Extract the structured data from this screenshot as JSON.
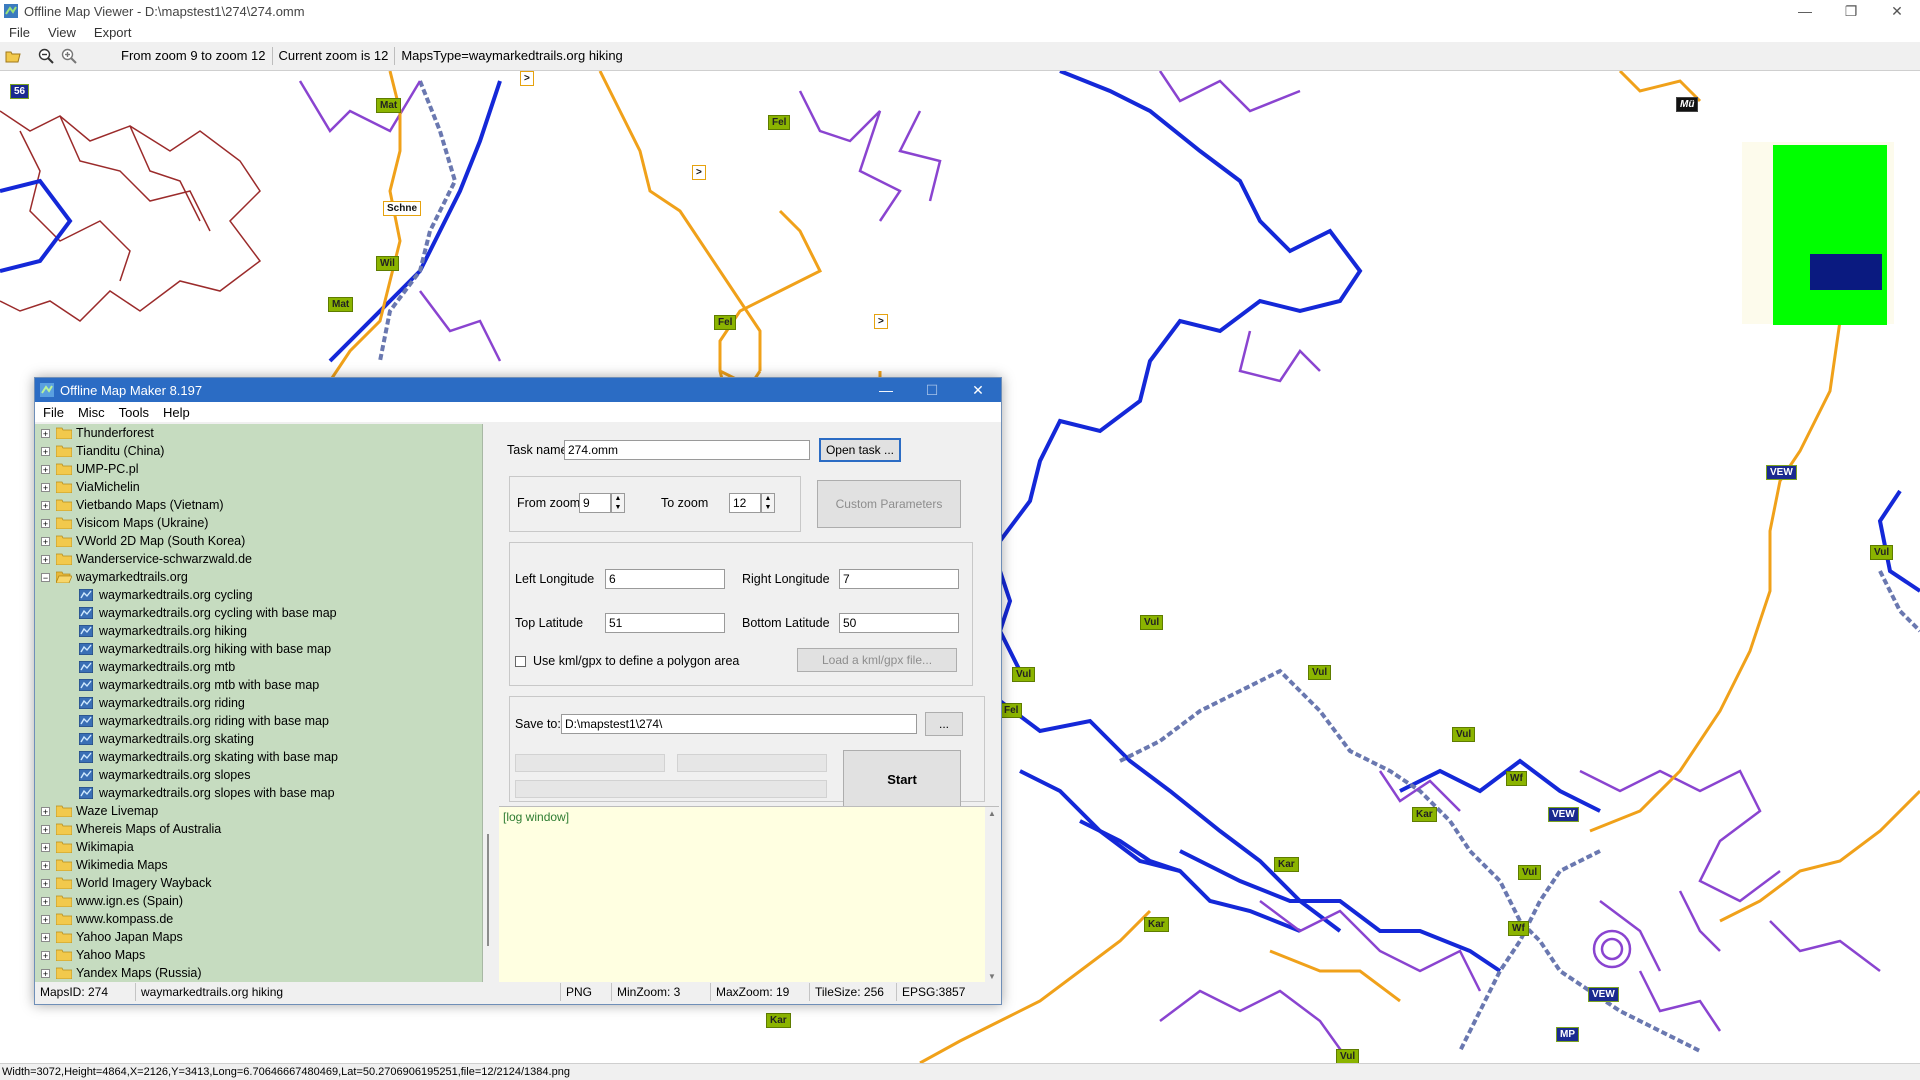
{
  "window": {
    "title": "Offline Map Viewer - D:\\mapstest1\\274\\274.omm"
  },
  "menu": [
    "File",
    "View",
    "Export"
  ],
  "toolbar": {
    "zoom_range": "From zoom 9 to zoom 12",
    "current_zoom": "Current zoom is 12",
    "maps_type": "MapsType=waymarkedtrails.org hiking"
  },
  "map_labels": [
    {
      "text": "56",
      "style": "navy"
    },
    {
      "text": "Mat",
      "style": "green"
    },
    {
      "text": "Fel",
      "style": "green"
    },
    {
      "text": ">",
      "style": "white"
    },
    {
      "text": "Schne",
      "style": "white"
    },
    {
      "text": "Wil",
      "style": "green"
    },
    {
      "text": "Mat",
      "style": "green"
    },
    {
      "text": "Fel",
      "style": "green"
    },
    {
      "text": ">",
      "style": "white"
    },
    {
      "text": ">",
      "style": "white"
    },
    {
      "text": "Mü",
      "style": "black"
    },
    {
      "text": "VEW",
      "style": "navy"
    },
    {
      "text": "Vul",
      "style": "green"
    },
    {
      "text": "Vul",
      "style": "green"
    },
    {
      "text": "Vul",
      "style": "green"
    },
    {
      "text": "Vul",
      "style": "green"
    },
    {
      "text": "Fel",
      "style": "green"
    },
    {
      "text": "Vul",
      "style": "green"
    },
    {
      "text": "Wf",
      "style": "green"
    },
    {
      "text": "Kar",
      "style": "green"
    },
    {
      "text": "VEW",
      "style": "navy"
    },
    {
      "text": "Kar",
      "style": "green"
    },
    {
      "text": "Vul",
      "style": "green"
    },
    {
      "text": "Kar",
      "style": "green"
    },
    {
      "text": "Wf",
      "style": "green"
    },
    {
      "text": "VEW",
      "style": "navy"
    },
    {
      "text": "MP",
      "style": "navy"
    },
    {
      "text": "Kar",
      "style": "green"
    },
    {
      "text": "Vul",
      "style": "green"
    }
  ],
  "status_bottom": "Width=3072,Height=4864,X=2126,Y=3413,Long=6.70646667480469,Lat=50.2706906195251,file=12/2124/1384.png",
  "dialog": {
    "title": "Offline Map Maker 8.197",
    "menu": [
      "File",
      "Misc",
      "Tools",
      "Help"
    ],
    "tree": {
      "top_items": [
        "Thunderforest",
        "Tianditu (China)",
        "UMP-PC.pl",
        "ViaMichelin",
        "Vietbando Maps (Vietnam)",
        "Visicom Maps (Ukraine)",
        "VWorld 2D Map (South Korea)",
        "Wanderservice-schwarzwald.de"
      ],
      "expanded": "waymarkedtrails.org",
      "children": [
        "waymarkedtrails.org cycling",
        "waymarkedtrails.org cycling with base map",
        "waymarkedtrails.org hiking",
        "waymarkedtrails.org hiking with base map",
        "waymarkedtrails.org mtb",
        "waymarkedtrails.org mtb with base map",
        "waymarkedtrails.org riding",
        "waymarkedtrails.org riding with base map",
        "waymarkedtrails.org skating",
        "waymarkedtrails.org skating with base map",
        "waymarkedtrails.org slopes",
        "waymarkedtrails.org slopes with base map"
      ],
      "bottom_items": [
        "Waze Livemap",
        "Whereis Maps of Australia",
        "Wikimapia",
        "Wikimedia Maps",
        "World Imagery Wayback",
        "www.ign.es (Spain)",
        "www.kompass.de",
        "Yahoo Japan Maps",
        "Yahoo Maps",
        "Yandex Maps (Russia)"
      ]
    },
    "task_name_label": "Task name",
    "task_name_value": "274.omm",
    "open_task": "Open task ...",
    "from_zoom_label": "From zoom",
    "from_zoom_value": "9",
    "to_zoom_label": "To zoom",
    "to_zoom_value": "12",
    "custom_params": "Custom Parameters",
    "left_lon_label": "Left Longitude",
    "left_lon_value": "6",
    "right_lon_label": "Right Longitude",
    "right_lon_value": "7",
    "top_lat_label": "Top Latitude",
    "top_lat_value": "51",
    "bottom_lat_label": "Bottom Latitude",
    "bottom_lat_value": "50",
    "kml_checkbox": "Use kml/gpx to define a polygon area",
    "load_kml": "Load a kml/gpx file...",
    "save_to_label": "Save to:",
    "save_to_value": "D:\\mapstest1\\274\\",
    "browse": "...",
    "start": "Start",
    "log": "[log window]",
    "status": {
      "maps_id": "MapsID: 274",
      "map_name": "waymarkedtrails.org hiking",
      "format": "PNG",
      "min_zoom": "MinZoom: 3",
      "max_zoom": "MaxZoom: 19",
      "tile_size": "TileSize: 256",
      "epsg": "EPSG:3857"
    }
  },
  "colors": {
    "accent": "#2b6cc4",
    "tree_bg": "#c6dcc0",
    "log_bg": "#ffffe1",
    "route_blue": "#1428d8",
    "route_purple": "#8a44d0",
    "route_orange": "#f0a11a",
    "border_red": "#9b2b2b"
  }
}
